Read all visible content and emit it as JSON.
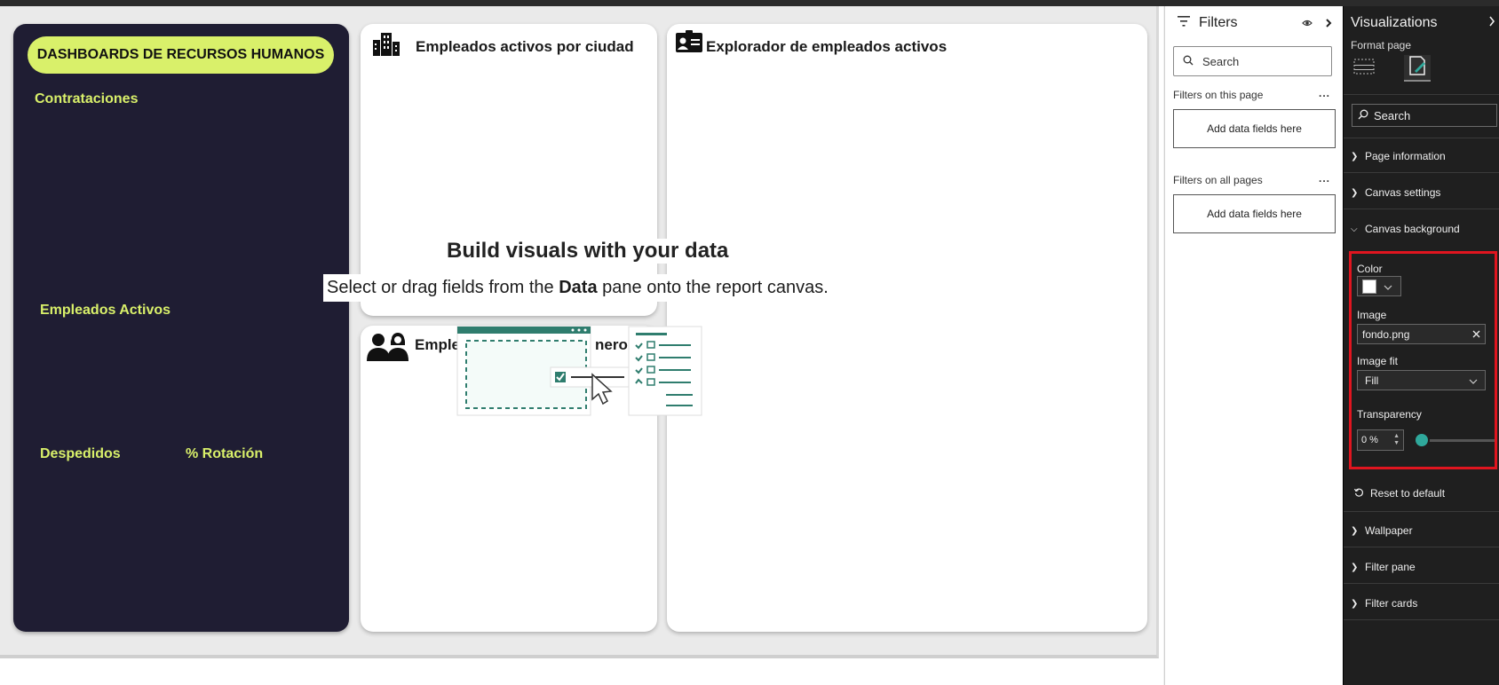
{
  "canvas": {
    "hr_panel": {
      "title": "DASHBOARDS DE RECURSOS HUMANOS",
      "labels": {
        "contrataciones": "Contrataciones",
        "empleados_activos": "Empleados Activos",
        "despedidos": "Despedidos",
        "rotacion": "% Rotación"
      }
    },
    "cards": {
      "ciudad_title": "Empleados activos por ciudad",
      "explorador_title": "Explorador de empleados activos",
      "genero_title_left": "Emple",
      "genero_title_right": "nero"
    },
    "empty_state": {
      "title": "Build visuals with your data",
      "sub_pre": "Select or drag fields from the ",
      "sub_bold": "Data",
      "sub_post": " pane onto the report canvas."
    }
  },
  "filters": {
    "title": "Filters",
    "search_placeholder": "Search",
    "this_page_label": "Filters on this page",
    "this_page_drop": "Add data fields here",
    "all_pages_label": "Filters on all pages",
    "all_pages_drop": "Add data fields here",
    "more": "..."
  },
  "visualizations": {
    "title": "Visualizations",
    "subtitle": "Format page",
    "search_placeholder": "Search",
    "sections": {
      "page_information": "Page information",
      "canvas_settings": "Canvas settings",
      "canvas_background": "Canvas background",
      "wallpaper": "Wallpaper",
      "filter_pane": "Filter pane",
      "filter_cards": "Filter cards"
    },
    "canvas_background": {
      "color_label": "Color",
      "color_value": "#ffffff",
      "image_label": "Image",
      "image_value": "fondo.png",
      "image_fit_label": "Image fit",
      "image_fit_value": "Fill",
      "transparency_label": "Transparency",
      "transparency_value": "0 %",
      "transparency_percent": 0
    },
    "reset": "Reset to default"
  },
  "colors": {
    "hr_panel_bg": "#1f1d33",
    "accent_lime": "#d9f06a",
    "highlight_red": "#e0151f",
    "slider_teal": "#2fa89b",
    "illustration_green": "#2f7d6e"
  }
}
